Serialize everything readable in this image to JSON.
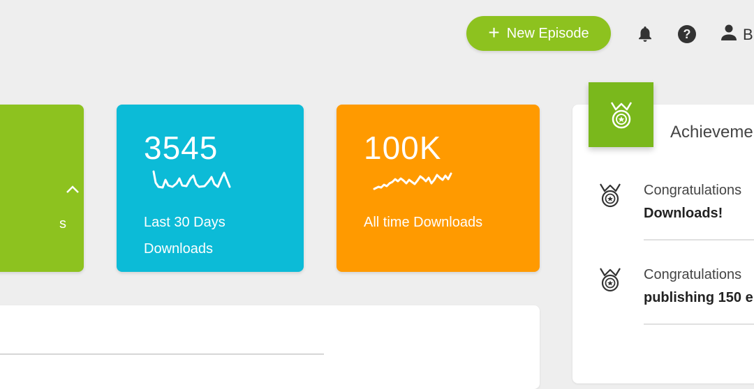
{
  "header": {
    "new_episode_label": "New Episode",
    "user_name": "B",
    "icons": [
      "bell-icon",
      "help-icon",
      "user-icon"
    ]
  },
  "stats": {
    "green_card": {
      "label": "s"
    },
    "last30": {
      "value": "3545",
      "label_line1": "Last 30 Days",
      "label_line2": "Downloads"
    },
    "alltime": {
      "value": "100K",
      "label": "All time Downloads"
    }
  },
  "achievements": {
    "title": "Achieveme",
    "items": [
      {
        "line1": "Congratulations",
        "line2": "Downloads!"
      },
      {
        "line1": "Congratulations",
        "line2": "publishing 150 e"
      }
    ]
  },
  "colors": {
    "green": "#8dc21f",
    "blue": "#0cbbd7",
    "orange": "#ff9a00",
    "background": "#eeeeee"
  }
}
